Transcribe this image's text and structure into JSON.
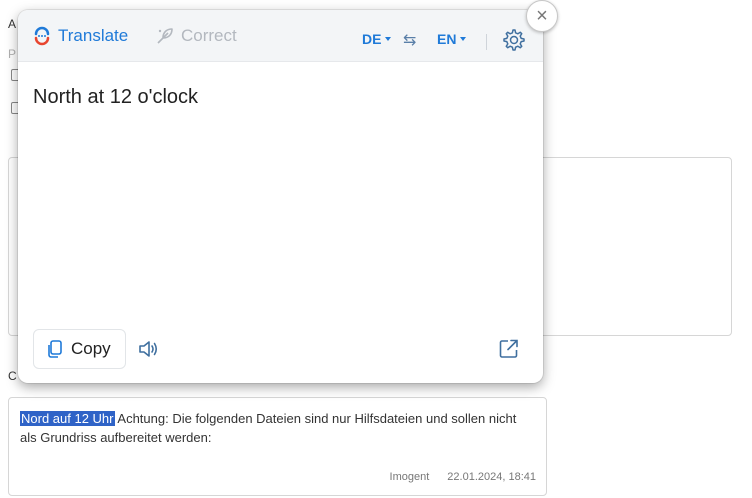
{
  "background": {
    "label_a": "A",
    "label_p": "P",
    "label_c": "C",
    "comment": {
      "highlight": "Nord auf 12 Uhr",
      "text": " Achtung: Die folgenden Dateien sind nur Hilfsdateien und sollen nicht als Grundriss aufbereitet werden:",
      "author": "Imogent",
      "timestamp": "22.01.2024, 18:41"
    }
  },
  "popup": {
    "tabs": {
      "translate": "Translate",
      "correct": "Correct"
    },
    "source_lang": "DE",
    "target_lang": "EN",
    "result_text": "North at 12 o'clock",
    "copy_label": "Copy",
    "icons": [
      "translate-logo-icon",
      "correct-feather-icon",
      "swap-icon",
      "gear-icon",
      "close-icon",
      "copy-icon",
      "speaker-icon",
      "external-link-icon"
    ],
    "colors": {
      "accent": "#1f7ad8",
      "muted": "#b3b8bf",
      "highlight": "#2f63c7"
    }
  }
}
